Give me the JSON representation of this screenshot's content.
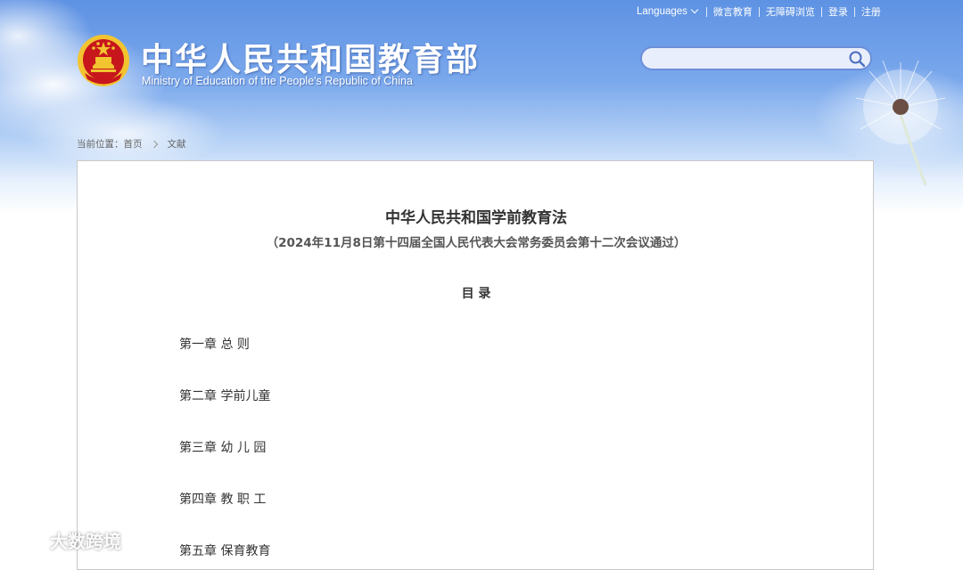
{
  "top_links": {
    "languages": "Languages",
    "weiyan": "微言教育",
    "accessible": "无障碍浏览",
    "login": "登录",
    "register": "注册"
  },
  "site": {
    "title_cn": "中华人民共和国教育部",
    "title_en": "Ministry of Education of the People's Republic of China"
  },
  "search": {
    "value": "",
    "placeholder": ""
  },
  "breadcrumb": {
    "prefix": "当前位置：",
    "home": "首页",
    "current": "文献"
  },
  "article": {
    "title": "中华人民共和国学前教育法",
    "subtitle": "（2024年11月8日第十四届全国人民代表大会常务委员会第十二次会议通过）",
    "toc_heading": "目 录",
    "toc": [
      "第一章 总 则",
      "第二章 学前儿童",
      "第三章 幼 儿 园",
      "第四章 教 职 工",
      "第五章 保育教育"
    ]
  },
  "watermark": {
    "text": "大数跨境"
  },
  "colors": {
    "header_blue": "#5e92e3",
    "emblem_red": "#c8161d",
    "emblem_gold": "#f2c430",
    "text_main": "#333333",
    "border": "#c9c9c9"
  },
  "icons": {
    "search": "search-icon",
    "languages_dropdown": "chevron-down-icon",
    "breadcrumb_separator": "chevron-right-icon",
    "emblem": "national-emblem",
    "watermark_logo": "watermark-logo-icon"
  }
}
